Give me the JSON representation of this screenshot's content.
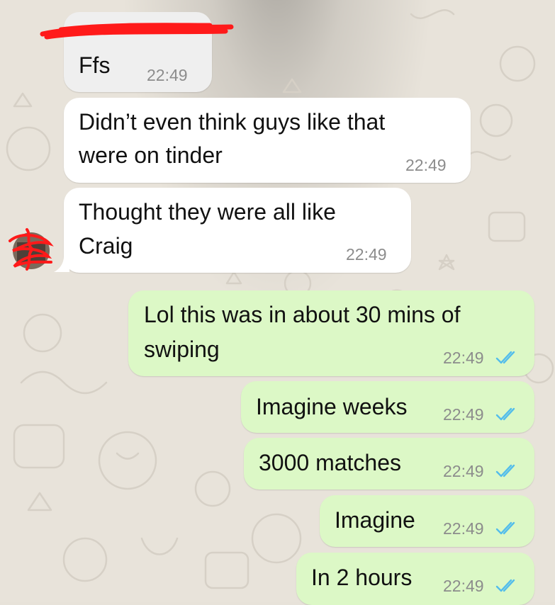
{
  "app": {
    "name": "WhatsApp-style chat",
    "accent_color": "#53bdeb",
    "incoming_bubble_color": "#ffffff",
    "outgoing_bubble_color": "#dcf8c6"
  },
  "messages": [
    {
      "direction": "incoming",
      "sender_redacted": true,
      "lines": [
        "Ffs"
      ],
      "time": "22:49"
    },
    {
      "direction": "incoming",
      "lines": [
        "Didn’t even think guys like that",
        "were on tinder"
      ],
      "time": "22:49"
    },
    {
      "direction": "incoming",
      "lines": [
        "Thought they were all like",
        "Craig"
      ],
      "time": "22:49",
      "avatar": "redacted-avatar"
    },
    {
      "direction": "outgoing",
      "lines": [
        "Lol this was in about 30 mins of",
        "swiping"
      ],
      "time": "22:49",
      "status": "read"
    },
    {
      "direction": "outgoing",
      "lines": [
        "Imagine weeks"
      ],
      "time": "22:49",
      "status": "read"
    },
    {
      "direction": "outgoing",
      "lines": [
        "3000 matches"
      ],
      "time": "22:49",
      "status": "read"
    },
    {
      "direction": "outgoing",
      "lines": [
        "Imagine"
      ],
      "time": "22:49",
      "status": "read"
    },
    {
      "direction": "outgoing",
      "lines": [
        "In 2 hours"
      ],
      "time": "22:49",
      "status": "read"
    }
  ],
  "icons": {
    "read_receipt": "double-check-icon",
    "redaction": "red-scribble"
  }
}
